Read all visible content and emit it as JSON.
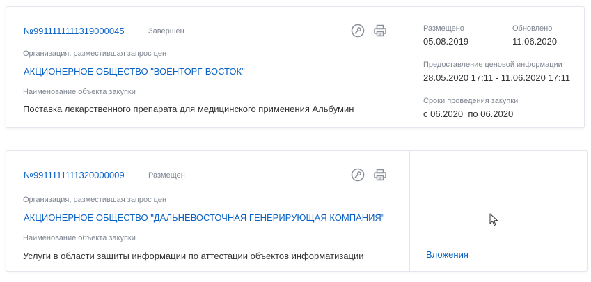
{
  "cards": [
    {
      "number": "№9911111111319000045",
      "status": "Завершен",
      "org_label": "Организация, разместившая запрос цен",
      "org_name": "АКЦИОНЕРНОЕ ОБЩЕСТВО \"ВОЕНТОРГ-ВОСТОК\"",
      "object_label": "Наименование объекта закупки",
      "object_name": "Поставка лекарственного препарата для медицинского применения Альбумин",
      "posted_label": "Размещено",
      "posted_value": "05.08.2019",
      "updated_label": "Обновлено",
      "updated_value": "11.06.2020",
      "price_info_label": "Предоставление ценовой информации",
      "price_info_value": "28.05.2020 17:11 - 11.06.2020 17:11",
      "period_label": "Сроки проведения закупки",
      "period_value": "с 06.2020  по 06.2020"
    },
    {
      "number": "№9911111111320000009",
      "status": "Размещен",
      "org_label": "Организация, разместившая запрос цен",
      "org_name": "АКЦИОНЕРНОЕ ОБЩЕСТВО \"ДАЛЬНЕВОСТОЧНАЯ ГЕНЕРИРУЮЩАЯ КОМПАНИЯ\"",
      "object_label": "Наименование объекта закупки",
      "object_name": "Услуги в области защиты информации по аттестации объектов информатизации",
      "attachments_label": "Вложения"
    }
  ],
  "icons": [
    "key-icon",
    "printer-icon",
    "mouse-cursor-icon"
  ],
  "colors": {
    "link": "#0a62c4",
    "muted": "#7e8590",
    "text": "#333333",
    "border": "#e3e6ec",
    "icon": "#8a9099"
  }
}
